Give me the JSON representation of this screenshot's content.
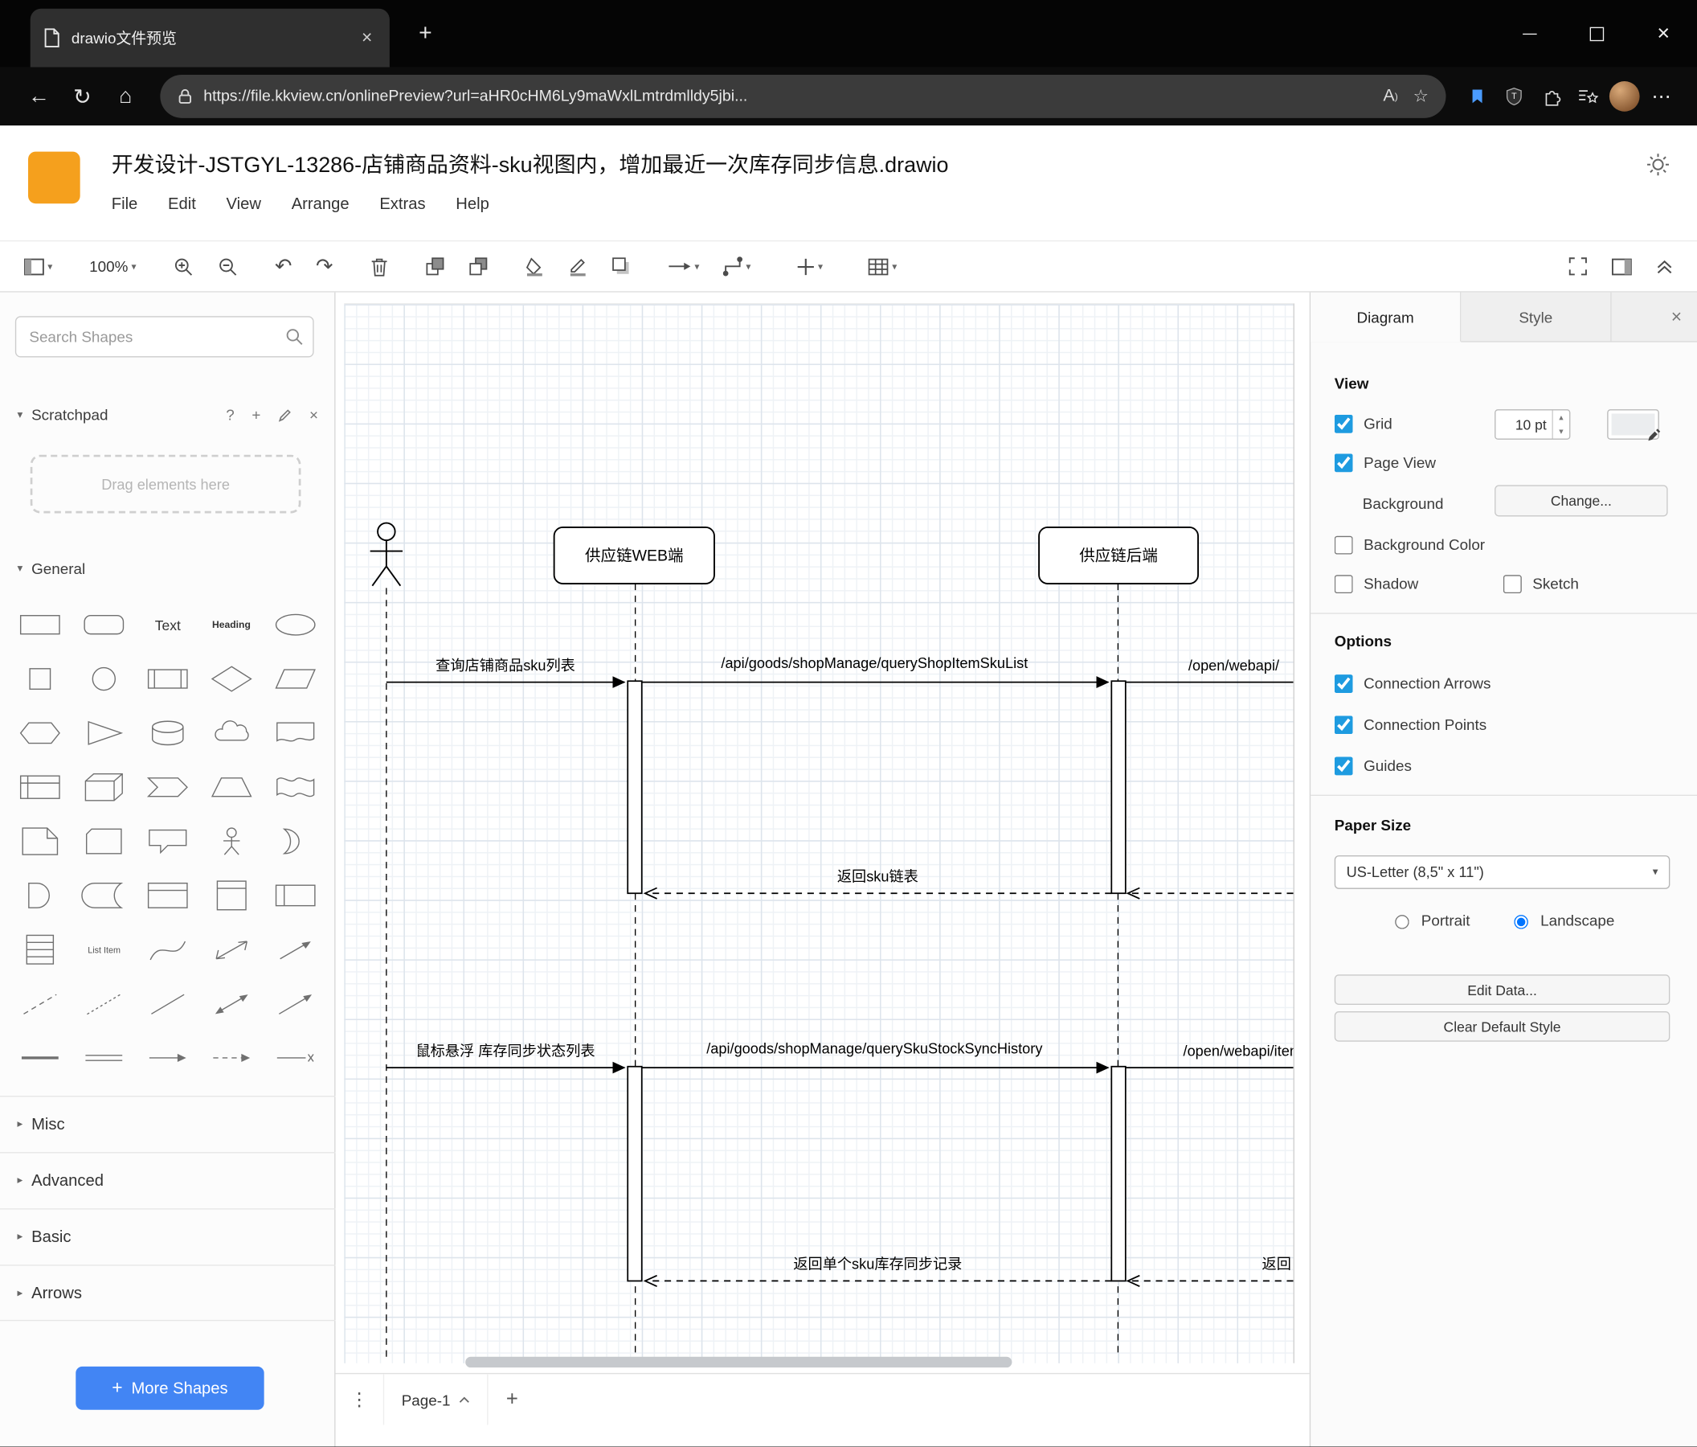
{
  "browser": {
    "tab_title": "drawio文件预览",
    "url": "https://file.kkview.cn/onlinePreview?url=aHR0cHM6Ly9maWxlLmtrdmlldy5jbi..."
  },
  "app": {
    "title": "开发设计-JSTGYL-13286-店铺商品资料-sku视图内，增加最近一次库存同步信息.drawio",
    "menus": [
      "File",
      "Edit",
      "View",
      "Arrange",
      "Extras",
      "Help"
    ],
    "zoom_level": "100%"
  },
  "shapes_panel": {
    "search_placeholder": "Search Shapes",
    "scratchpad_label": "Scratchpad",
    "dropzone_text": "Drag elements here",
    "section_general": "General",
    "section_misc": "Misc",
    "section_advanced": "Advanced",
    "section_basic": "Basic",
    "section_arrows": "Arrows",
    "more_shapes_label": "More Shapes",
    "thumb_text": "Text",
    "thumb_heading": "Heading",
    "thumb_list_item": "List Item",
    "general_shapes": [
      "rectangle",
      "rounded-rectangle",
      "text",
      "heading",
      "ellipse",
      "square",
      "circle",
      "process",
      "diamond",
      "parallelogram",
      "hexagon",
      "triangle",
      "cylinder",
      "cloud",
      "document",
      "internal-storage",
      "cube",
      "step",
      "trapezoid",
      "tape",
      "note",
      "card",
      "callout",
      "actor",
      "or",
      "and",
      "data-storage",
      "container",
      "vertical-container",
      "horizontal-container",
      "list",
      "list-item",
      "curve",
      "bidirectional-arrow",
      "arrow",
      "dashed-line",
      "dotted-line",
      "line",
      "bidirectional-diagonal",
      "diagonal-arrow",
      "divider",
      "link",
      "simple-arrow",
      "dashed-arrow",
      "cross-arrow"
    ]
  },
  "canvas": {
    "page_tab": "Page-1",
    "lifeline_web": "供应链WEB端",
    "lifeline_backend": "供应链后端",
    "msg_query_sku_list": "查询店铺商品sku列表",
    "msg_api_query_shop_item_sku_list": "/api/goods/shopManage/queryShopItemSkuList",
    "msg_open_webapi_1": "/open/webapi/",
    "msg_return_sku_list": "返回sku链表",
    "msg_hover_stock_sync": "鼠标悬浮 库存同步状态列表",
    "msg_api_query_sku_stock_sync_history": "/api/goods/shopManage/querySkuStockSyncHistory",
    "msg_open_webapi_2": "/open/webapi/item",
    "msg_return_single_sku": "返回单个sku库存同步记录",
    "msg_return_partial": "返回"
  },
  "format_panel": {
    "tab_diagram": "Diagram",
    "tab_style": "Style",
    "view_heading": "View",
    "grid_label": "Grid",
    "grid_size": "10 pt",
    "page_view_label": "Page View",
    "background_label": "Background",
    "change_button": "Change...",
    "background_color_label": "Background Color",
    "shadow_label": "Shadow",
    "sketch_label": "Sketch",
    "options_heading": "Options",
    "connection_arrows_label": "Connection Arrows",
    "connection_points_label": "Connection Points",
    "guides_label": "Guides",
    "paper_heading": "Paper Size",
    "paper_size_value": "US-Letter (8,5\" x 11\")",
    "portrait_label": "Portrait",
    "landscape_label": "Landscape",
    "edit_data_button": "Edit Data...",
    "clear_default_style_button": "Clear Default Style"
  },
  "colors": {
    "accent_blue": "#1e9be0",
    "logo_orange": "#f5a01d",
    "more_shapes_blue": "#4285f4"
  }
}
